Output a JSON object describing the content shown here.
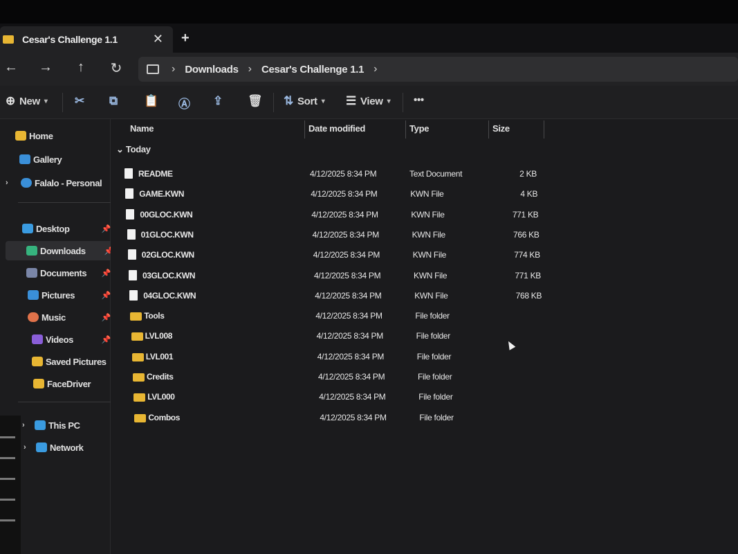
{
  "tab": {
    "title": "Cesar's Challenge 1.1",
    "close": "✕",
    "new_tab": "+"
  },
  "nav": {
    "back": "←",
    "forward": "→",
    "up": "↑",
    "refresh": "↻",
    "breadcrumbs": [
      "Downloads",
      "Cesar's Challenge 1.1"
    ]
  },
  "toolbar": {
    "new_label": "New",
    "sort_label": "Sort",
    "view_label": "View",
    "more_label": "•••"
  },
  "sidebar": {
    "items": [
      {
        "label": "Home",
        "icon": "home-icon",
        "color": "#e8b633"
      },
      {
        "label": "Gallery",
        "icon": "gallery-icon",
        "color": "#3a8fd8"
      },
      {
        "label": "Falalo - Personal",
        "icon": "cloud-icon",
        "color": "#3a8fd8"
      },
      {
        "label": "Desktop",
        "icon": "desktop-icon",
        "color": "#3a9be0"
      },
      {
        "label": "Downloads",
        "icon": "download-icon",
        "color": "#36b37e"
      },
      {
        "label": "Documents",
        "icon": "documents-icon",
        "color": "#7a86a8"
      },
      {
        "label": "Pictures",
        "icon": "pictures-icon",
        "color": "#3a8fd8"
      },
      {
        "label": "Music",
        "icon": "music-icon",
        "color": "#e0724a"
      },
      {
        "label": "Videos",
        "icon": "videos-icon",
        "color": "#8a5ed8"
      },
      {
        "label": "Saved Pictures",
        "icon": "folder-icon",
        "color": "#e8b633"
      },
      {
        "label": "FaceDriver",
        "icon": "folder-icon",
        "color": "#e8b633"
      },
      {
        "label": "This PC",
        "icon": "pc-icon",
        "color": "#3a9be0"
      },
      {
        "label": "Network",
        "icon": "network-icon",
        "color": "#3a9be0"
      }
    ]
  },
  "columns": {
    "name": "Name",
    "date": "Date modified",
    "type": "Type",
    "size": "Size"
  },
  "group_label": "Today",
  "files": [
    {
      "name": "README",
      "date": "4/12/2025 8:34 PM",
      "type": "Text Document",
      "size": "2 KB",
      "kind": "file"
    },
    {
      "name": "GAME.KWN",
      "date": "4/12/2025 8:34 PM",
      "type": "KWN File",
      "size": "4 KB",
      "kind": "file"
    },
    {
      "name": "00GLOC.KWN",
      "date": "4/12/2025 8:34 PM",
      "type": "KWN File",
      "size": "771 KB",
      "kind": "file"
    },
    {
      "name": "01GLOC.KWN",
      "date": "4/12/2025 8:34 PM",
      "type": "KWN File",
      "size": "766 KB",
      "kind": "file"
    },
    {
      "name": "02GLOC.KWN",
      "date": "4/12/2025 8:34 PM",
      "type": "KWN File",
      "size": "774 KB",
      "kind": "file"
    },
    {
      "name": "03GLOC.KWN",
      "date": "4/12/2025 8:34 PM",
      "type": "KWN File",
      "size": "771 KB",
      "kind": "file"
    },
    {
      "name": "04GLOC.KWN",
      "date": "4/12/2025 8:34 PM",
      "type": "KWN File",
      "size": "768 KB",
      "kind": "file"
    },
    {
      "name": "Tools",
      "date": "4/12/2025 8:34 PM",
      "type": "File folder",
      "size": "",
      "kind": "folder"
    },
    {
      "name": "LVL008",
      "date": "4/12/2025 8:34 PM",
      "type": "File folder",
      "size": "",
      "kind": "folder"
    },
    {
      "name": "LVL001",
      "date": "4/12/2025 8:34 PM",
      "type": "File folder",
      "size": "",
      "kind": "folder"
    },
    {
      "name": "Credits",
      "date": "4/12/2025 8:34 PM",
      "type": "File folder",
      "size": "",
      "kind": "folder"
    },
    {
      "name": "LVL000",
      "date": "4/12/2025 8:34 PM",
      "type": "File folder",
      "size": "",
      "kind": "folder"
    },
    {
      "name": "Combos",
      "date": "4/12/2025 8:34 PM",
      "type": "File folder",
      "size": "",
      "kind": "folder"
    }
  ]
}
